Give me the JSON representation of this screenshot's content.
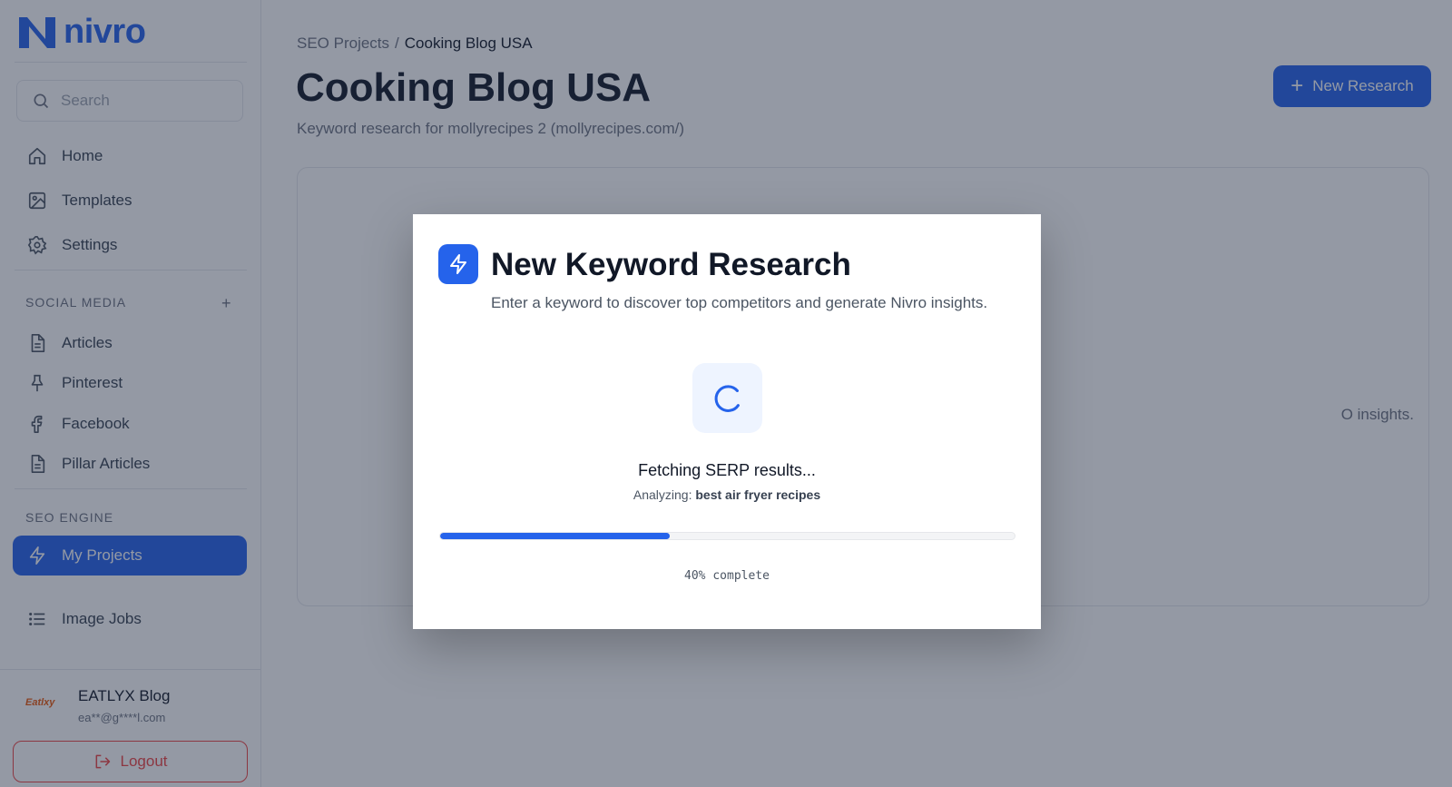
{
  "brand": {
    "name": "nivro",
    "color": "#2563eb"
  },
  "search": {
    "placeholder": "Search"
  },
  "sidebar": {
    "main_items": [
      {
        "label": "Home",
        "icon": "home-icon"
      },
      {
        "label": "Templates",
        "icon": "image-icon"
      },
      {
        "label": "Settings",
        "icon": "gear-icon"
      }
    ],
    "social_section": {
      "label": "SOCIAL MEDIA",
      "add_label": "+",
      "items": [
        {
          "label": "Articles",
          "icon": "document-icon"
        },
        {
          "label": "Pinterest",
          "icon": "pin-icon"
        },
        {
          "label": "Facebook",
          "icon": "facebook-icon"
        },
        {
          "label": "Pillar Articles",
          "icon": "document-icon"
        }
      ]
    },
    "seo_section": {
      "label": "SEO ENGINE",
      "items": [
        {
          "label": "My Projects",
          "icon": "lightning-icon",
          "active": true
        }
      ]
    },
    "extra_items": [
      {
        "label": "Image Jobs",
        "icon": "list-icon"
      }
    ],
    "user": {
      "logo_text": "Eatlxy",
      "name": "EATLYX Blog",
      "email": "ea**@g****l.com"
    },
    "logout_label": "Logout"
  },
  "main": {
    "breadcrumb": {
      "parent": "SEO Projects",
      "separator": "/",
      "current": "Cooking Blog USA"
    },
    "title": "Cooking Blog USA",
    "subtitle": "Keyword research for mollyrecipes 2 (mollyrecipes.com/)",
    "new_research_label": "New Research",
    "new_research_plus": "+",
    "empty_text_visible": "O insights."
  },
  "modal": {
    "title": "New Keyword Research",
    "subtitle": "Enter a keyword to discover top competitors and generate Nivro insights.",
    "status_title": "Fetching SERP results...",
    "status_prefix": "Analyzing: ",
    "keyword": "best air fryer recipes",
    "progress": 0.4,
    "progress_text": "40% complete"
  },
  "colors": {
    "accent": "#2563eb",
    "danger": "#ef4444",
    "overlay": "rgba(31,41,64,0.48)"
  }
}
